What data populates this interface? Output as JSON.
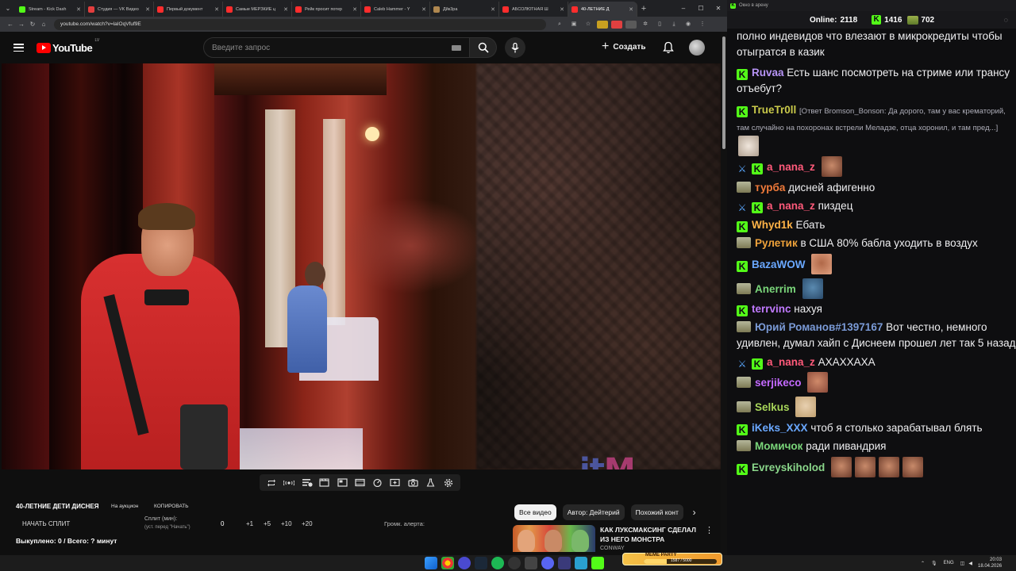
{
  "browser": {
    "tabs": [
      {
        "title": "Stream - Kick Dash",
        "color": "#53fc18",
        "active": false
      },
      {
        "title": "Студия — VK Видео",
        "color": "#e33e3e",
        "active": false
      },
      {
        "title": "Первый документ",
        "color": "#ff2d2d",
        "active": false
      },
      {
        "title": "Самые МЕРЗКИЕ ц",
        "color": "#ff2d2d",
        "active": false
      },
      {
        "title": "Рейк просит потер",
        "color": "#ff2d2d",
        "active": false
      },
      {
        "title": "Caleb Hammer - Y",
        "color": "#ff2d2d",
        "active": false
      },
      {
        "title": "Дйк3ра",
        "color": "#b08850",
        "active": false
      },
      {
        "title": "АБСОЛЮТНАЯ Ш",
        "color": "#ff2d2d",
        "active": false
      },
      {
        "title": "40-ЛЕТНИЕ Д",
        "color": "#ff2d2d",
        "active": true
      }
    ],
    "url": "youtube.com/watch?v=laIOqVfuf9E"
  },
  "youtube": {
    "logo_text": "YouTube",
    "region": "LV",
    "search_placeholder": "Введите запрос",
    "create_label": "Создать"
  },
  "video": {
    "watermark_part1": "it",
    "watermark_part2": "M"
  },
  "extension": {
    "title": "40-ЛЕТНИЕ ДЕТИ ДИСНЕЯ",
    "auction_label": "На аукцион",
    "copy_label": "КОПИРОВАТЬ",
    "start_split_label": "НАЧАТЬ СПЛИТ",
    "split_label": "Сплит (мин):",
    "split_note": "(уст. перед \"Начать\")",
    "split_value": "0",
    "steps": [
      "+1",
      "+5",
      "+10",
      "+20"
    ],
    "alert_volume_label": "Громк. алерта:",
    "bought_status": "Выкуплено: 0 / Всего: ? минут"
  },
  "recommendations": {
    "chips": [
      "Все видео",
      "Автор: Дейтерий",
      "Похожий конт"
    ],
    "item_title_line1": "КАК ЛУКСМАКСИНГ СДЕЛАЛ",
    "item_title_line2": "ИЗ НЕГО МОНСТРА",
    "item_channel": "CONWAY"
  },
  "chat": {
    "window_title": "Окно в арену",
    "online_label": "Online:",
    "online_count": "2118",
    "k_count": "1416",
    "gift_count": "702",
    "messages": [
      {
        "user": "",
        "user_color": "#efeff1",
        "text": "полно индевидов что влезают в микрокредиты чтобы отыгратся в казик",
        "badges": []
      },
      {
        "user": "Ruvaa",
        "user_color": "#b794f6",
        "text": "Есть шанс посмотреть на стриме или трансу отъебут?",
        "badges": [
          "k"
        ]
      },
      {
        "user": "TrueTr0ll",
        "user_color": "#c9c94a",
        "reply": "[Ответ Bromson_Bonson: Да дорого, там у вас крематорий, там случайно на похоронах встрели Меладзе, отца хоронил, и там пред...]",
        "text": "",
        "badges": [
          "k"
        ]
      },
      {
        "user": "a_nana_z",
        "user_color": "#ff5a7a",
        "text": "",
        "badges": [
          "sword",
          "k"
        ]
      },
      {
        "user": "турба",
        "user_color": "#f07a3a",
        "text": "дисней афигенно",
        "badges": [
          "gift"
        ]
      },
      {
        "user": "a_nana_z",
        "user_color": "#ff5a7a",
        "text": "пиздец",
        "badges": [
          "sword",
          "k"
        ]
      },
      {
        "user": "Whyd1k",
        "user_color": "#ffb347",
        "text": "Ебать",
        "badges": [
          "k"
        ]
      },
      {
        "user": "Рулетик",
        "user_color": "#f0a33a",
        "text": "в США 80% бабла уходить в воздух",
        "badges": [
          "gift"
        ]
      },
      {
        "user": "BazaWOW",
        "user_color": "#6aa8ff",
        "text": "",
        "badges": [
          "k"
        ]
      },
      {
        "user": "Anerrim",
        "user_color": "#7ad67a",
        "text": "",
        "badges": [
          "gift"
        ]
      },
      {
        "user": "terrvinc",
        "user_color": "#c07aff",
        "text": "нахуя",
        "badges": [
          "k"
        ]
      },
      {
        "user": "Юрий Романов#1397167",
        "user_color": "#7a9ad6",
        "text": "Вот честно, немного удивлен, думал хайп с Диснеем прошел лет так 5 назад",
        "badges": [
          "gift"
        ]
      },
      {
        "user": "a_nana_z",
        "user_color": "#ff5a7a",
        "text": "АХАХХАХА",
        "badges": [
          "sword",
          "k"
        ]
      },
      {
        "user": "serjikeco",
        "user_color": "#c46aff",
        "text": "",
        "badges": [
          "gift"
        ]
      },
      {
        "user": "Selkus",
        "user_color": "#a8d65a",
        "text": "",
        "badges": [
          "gift"
        ]
      },
      {
        "user": "iKeks_XXX",
        "user_color": "#6aa8ff",
        "text": "чтоб я столько зарабатывал блять",
        "badges": [
          "k"
        ]
      },
      {
        "user": "Момичок",
        "user_color": "#7ad67a",
        "text": "ради пивандрия",
        "badges": [
          "gift"
        ]
      },
      {
        "user": "Evreyskiholod",
        "user_color": "#8ad68a",
        "text": "",
        "badges": [
          "k"
        ]
      }
    ]
  },
  "taskbar": {
    "lang": "ENG",
    "time": "20:03",
    "date": "18.04.2026",
    "widget_label": "MEME PARTY",
    "widget_value": "1587 / 5000",
    "widget_progress": 0.32
  },
  "colors": {
    "kick_green": "#53fc18",
    "yt_red": "#ff0000",
    "bg_dark": "#0f0f0f"
  }
}
